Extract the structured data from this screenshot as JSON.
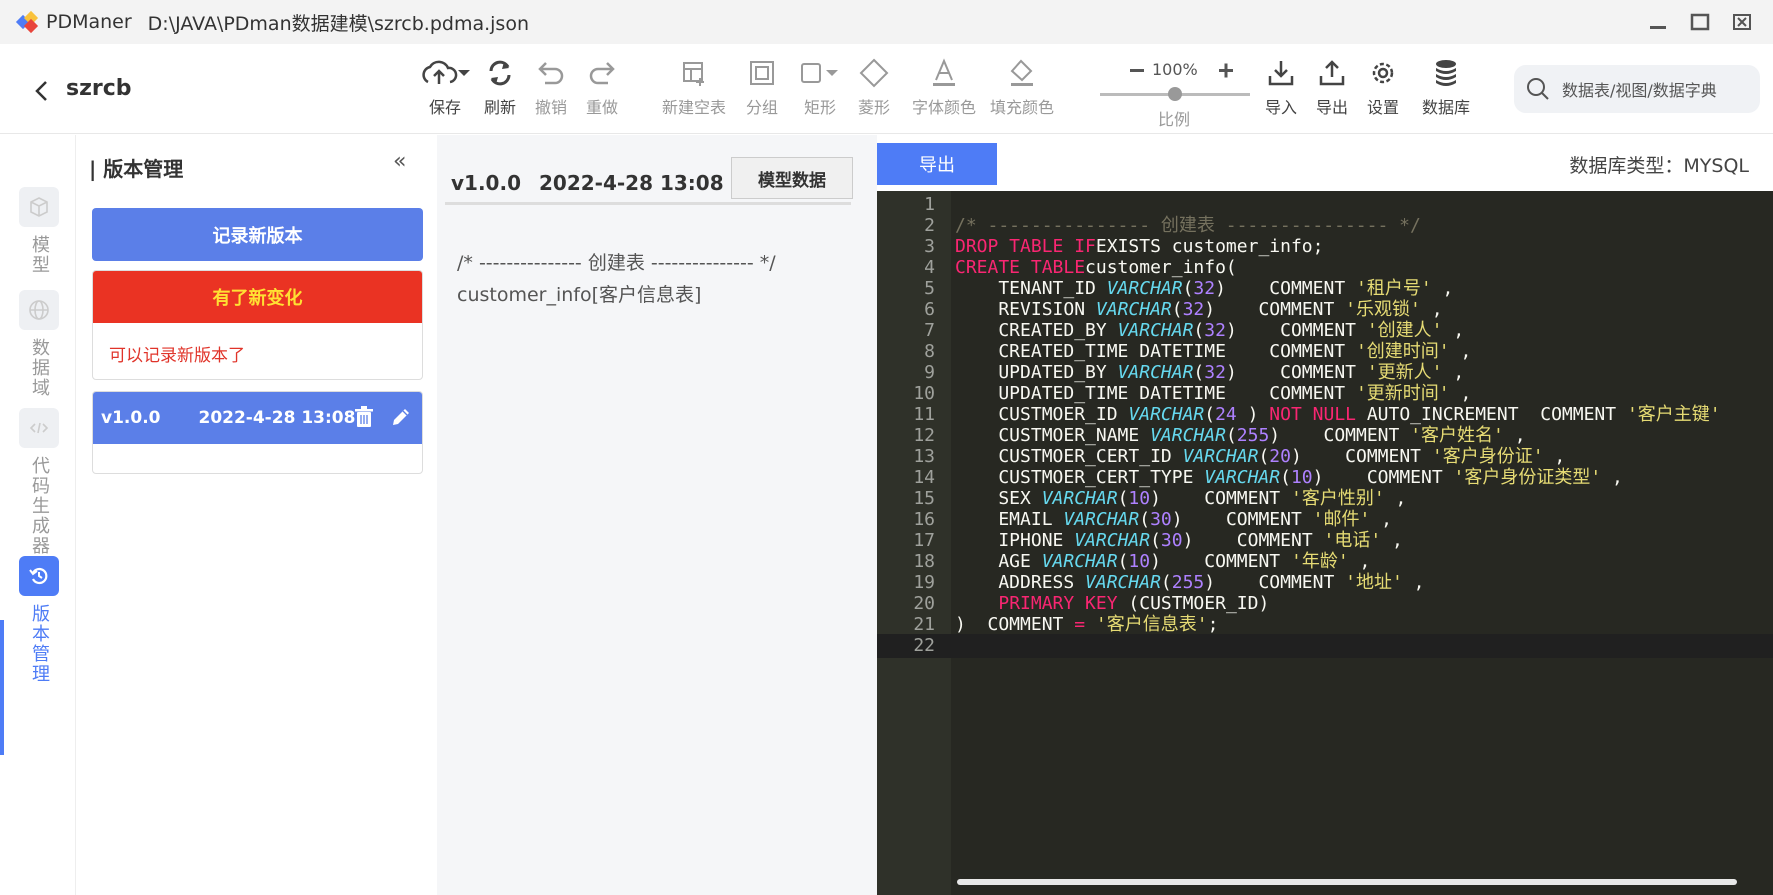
{
  "window": {
    "app_name": "PDManer",
    "file_path": "D:\\JAVA\\PDman数据建模\\szrcb.pdma.json"
  },
  "project": {
    "name": "szrcb"
  },
  "toolbar": {
    "items": [
      {
        "label": "保存",
        "icon": "cloud-upload-icon"
      },
      {
        "label": "刷新",
        "icon": "refresh-icon"
      },
      {
        "label": "撤销",
        "icon": "undo-icon"
      },
      {
        "label": "重做",
        "icon": "redo-icon"
      },
      {
        "label": "新建空表",
        "icon": "new-table-icon"
      },
      {
        "label": "分组",
        "icon": "group-icon"
      },
      {
        "label": "矩形",
        "icon": "rectangle-icon"
      },
      {
        "label": "菱形",
        "icon": "diamond-icon"
      },
      {
        "label": "字体颜色",
        "icon": "font-color-icon"
      },
      {
        "label": "填充颜色",
        "icon": "fill-color-icon"
      }
    ],
    "zoom": {
      "value": "100%",
      "label": "比例",
      "level": 0.5
    },
    "right_items": [
      {
        "label": "导入",
        "icon": "import-icon"
      },
      {
        "label": "导出",
        "icon": "export-icon"
      },
      {
        "label": "设置",
        "icon": "settings-icon"
      },
      {
        "label": "数据库",
        "icon": "database-icon"
      }
    ],
    "search_placeholder": "数据表/视图/数据字典"
  },
  "leftnav": [
    {
      "label": "模型",
      "icon": "cube-icon"
    },
    {
      "label": "数据域",
      "icon": "globe-icon"
    },
    {
      "label": "代码生成器",
      "icon": "code-icon"
    },
    {
      "label": "版本管理",
      "icon": "history-icon",
      "active": true
    }
  ],
  "panel": {
    "title": "版本管理",
    "record_button": "记录新版本",
    "change_title": "有了新变化",
    "change_message": "可以记录新版本了",
    "versions": [
      {
        "version": "v1.0.0",
        "date": "2022-4-28 13:08"
      }
    ]
  },
  "middle": {
    "version": "v1.0.0",
    "date": "2022-4-28 13:08",
    "model_button": "模型数据",
    "line1": "/* --------------- 创建表 --------------- */",
    "line2": "customer_info[客户信息表]"
  },
  "right": {
    "export_button": "导出",
    "db_type": "数据库类型：MYSQL"
  },
  "colors": {
    "accent": "#4e7cf6",
    "alert": "#ea3323",
    "editor_bg": "#272822"
  },
  "code_lines": [
    [],
    [
      [
        "c-com",
        "/* --------------- 创建表 --------------- */"
      ]
    ],
    [
      [
        "c-kw",
        "DROP TABLE IF"
      ],
      [
        "",
        "EXISTS customer_info;"
      ]
    ],
    [
      [
        "c-kw",
        "CREATE TABLE"
      ],
      [
        "",
        "customer_info("
      ]
    ],
    [
      [
        "",
        "    TENANT_ID "
      ],
      [
        "c-ty",
        "VARCHAR"
      ],
      [
        "",
        "("
      ],
      [
        "c-num",
        "32"
      ],
      [
        "",
        ")    COMMENT "
      ],
      [
        "c-str",
        "'租户号'"
      ],
      [
        "",
        " ,"
      ]
    ],
    [
      [
        "",
        "    REVISION "
      ],
      [
        "c-ty",
        "VARCHAR"
      ],
      [
        "",
        "("
      ],
      [
        "c-num",
        "32"
      ],
      [
        "",
        ")    COMMENT "
      ],
      [
        "c-str",
        "'乐观锁'"
      ],
      [
        "",
        " ,"
      ]
    ],
    [
      [
        "",
        "    CREATED_BY "
      ],
      [
        "c-ty",
        "VARCHAR"
      ],
      [
        "",
        "("
      ],
      [
        "c-num",
        "32"
      ],
      [
        "",
        ")    COMMENT "
      ],
      [
        "c-str",
        "'创建人'"
      ],
      [
        "",
        " ,"
      ]
    ],
    [
      [
        "",
        "    CREATED_TIME DATETIME    COMMENT "
      ],
      [
        "c-str",
        "'创建时间'"
      ],
      [
        "",
        " ,"
      ]
    ],
    [
      [
        "",
        "    UPDATED_BY "
      ],
      [
        "c-ty",
        "VARCHAR"
      ],
      [
        "",
        "("
      ],
      [
        "c-num",
        "32"
      ],
      [
        "",
        ")    COMMENT "
      ],
      [
        "c-str",
        "'更新人'"
      ],
      [
        "",
        " ,"
      ]
    ],
    [
      [
        "",
        "    UPDATED_TIME DATETIME    COMMENT "
      ],
      [
        "c-str",
        "'更新时间'"
      ],
      [
        "",
        " ,"
      ]
    ],
    [
      [
        "",
        "    CUSTMOER_ID "
      ],
      [
        "c-ty",
        "VARCHAR"
      ],
      [
        "",
        "("
      ],
      [
        "c-num",
        "24"
      ],
      [
        "",
        " ) "
      ],
      [
        "c-kw",
        "NOT NULL"
      ],
      [
        "",
        " AUTO_INCREMENT  COMMENT "
      ],
      [
        "c-str",
        "'客户主键'"
      ]
    ],
    [
      [
        "",
        "    CUSTMOER_NAME "
      ],
      [
        "c-ty",
        "VARCHAR"
      ],
      [
        "",
        "("
      ],
      [
        "c-num",
        "255"
      ],
      [
        "",
        ")    COMMENT "
      ],
      [
        "c-str",
        "'客户姓名'"
      ],
      [
        "",
        " ,"
      ]
    ],
    [
      [
        "",
        "    CUSTMOER_CERT_ID "
      ],
      [
        "c-ty",
        "VARCHAR"
      ],
      [
        "",
        "("
      ],
      [
        "c-num",
        "20"
      ],
      [
        "",
        ")    COMMENT "
      ],
      [
        "c-str",
        "'客户身份证'"
      ],
      [
        "",
        " ,"
      ]
    ],
    [
      [
        "",
        "    CUSTMOER_CERT_TYPE "
      ],
      [
        "c-ty",
        "VARCHAR"
      ],
      [
        "",
        "("
      ],
      [
        "c-num",
        "10"
      ],
      [
        "",
        ")    COMMENT "
      ],
      [
        "c-str",
        "'客户身份证类型'"
      ],
      [
        "",
        " ,"
      ]
    ],
    [
      [
        "",
        "    SEX "
      ],
      [
        "c-ty",
        "VARCHAR"
      ],
      [
        "",
        "("
      ],
      [
        "c-num",
        "10"
      ],
      [
        "",
        ")    COMMENT "
      ],
      [
        "c-str",
        "'客户性别'"
      ],
      [
        "",
        " ,"
      ]
    ],
    [
      [
        "",
        "    EMAIL "
      ],
      [
        "c-ty",
        "VARCHAR"
      ],
      [
        "",
        "("
      ],
      [
        "c-num",
        "30"
      ],
      [
        "",
        ")    COMMENT "
      ],
      [
        "c-str",
        "'邮件'"
      ],
      [
        "",
        " ,"
      ]
    ],
    [
      [
        "",
        "    IPHONE "
      ],
      [
        "c-ty",
        "VARCHAR"
      ],
      [
        "",
        "("
      ],
      [
        "c-num",
        "30"
      ],
      [
        "",
        ")    COMMENT "
      ],
      [
        "c-str",
        "'电话'"
      ],
      [
        "",
        " ,"
      ]
    ],
    [
      [
        "",
        "    AGE "
      ],
      [
        "c-ty",
        "VARCHAR"
      ],
      [
        "",
        "("
      ],
      [
        "c-num",
        "10"
      ],
      [
        "",
        ")    COMMENT "
      ],
      [
        "c-str",
        "'年龄'"
      ],
      [
        "",
        " ,"
      ]
    ],
    [
      [
        "",
        "    ADDRESS "
      ],
      [
        "c-ty",
        "VARCHAR"
      ],
      [
        "",
        "("
      ],
      [
        "c-num",
        "255"
      ],
      [
        "",
        ")    COMMENT "
      ],
      [
        "c-str",
        "'地址'"
      ],
      [
        "",
        " ,"
      ]
    ],
    [
      [
        "",
        "    "
      ],
      [
        "c-kw",
        "PRIMARY KEY"
      ],
      [
        "",
        " (CUSTMOER_ID)"
      ]
    ],
    [
      [
        "",
        ")  COMMENT "
      ],
      [
        "c-kw",
        "="
      ],
      [
        "",
        " "
      ],
      [
        "c-str",
        "'客户信息表'"
      ],
      [
        "",
        ";"
      ]
    ],
    []
  ]
}
